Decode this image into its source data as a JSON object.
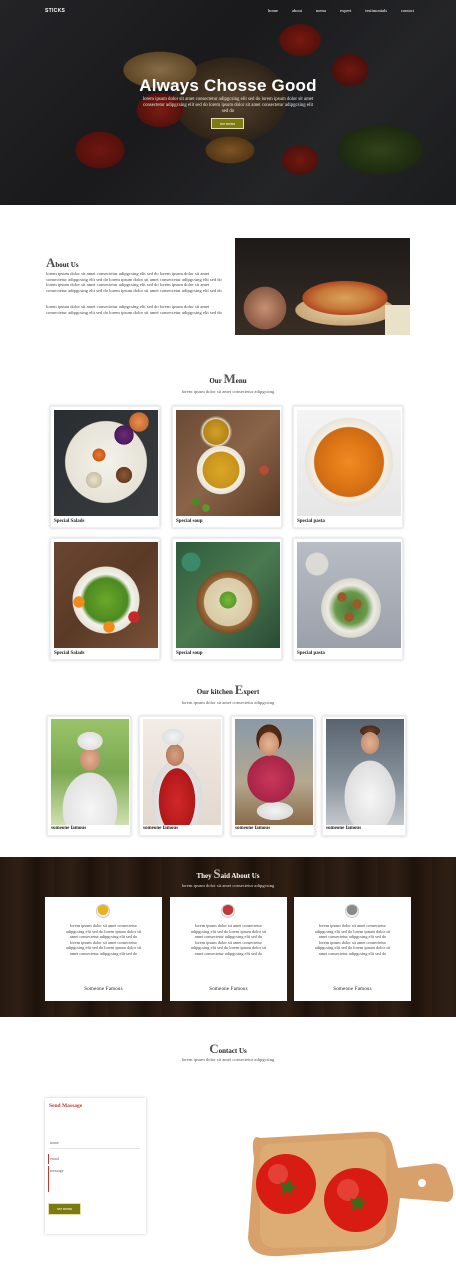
{
  "header": {
    "brand": "STICKS",
    "nav": [
      "home",
      "about",
      "menu",
      "expert",
      "testimonials",
      "contact"
    ]
  },
  "hero": {
    "title": "Always Chosse Good",
    "text": "lorem ipsum dolor sit amet consectetur adipgcsing elit sed do lorem ipsum dolor sit amet consectetur adipgcsing elit sed do lorem ipsum dolor sit amet consectetur adipgcsing elit sed do",
    "button": "see menu"
  },
  "about": {
    "title_first": "A",
    "title_rest": "bout Us",
    "p1": "lorem ipsum dolor sit amet consectetur adipgcsing elit sed do lorem ipsum dolor sit amet consectetur adipgcsing elit sed do lorem ipsum dolor sit amet consectetur adipgcsing elit sed do lorem ipsum dolor sit amet consectetur adipgcsing elit sed do lorem ipsum dolor sit amet consectetur adipgcsing elit sed do lorem ipsum dolor sit amet consectetur adipgcsing elit sed do",
    "p2": "lorem ipsum dolor sit amet consectetur adipgcsing elit sed do lorem ipsum dolor sit amet consectetur adipgcsing elit sed do lorem ipsum dolor sit amet consectetur adipgcsing elit sed do"
  },
  "menu": {
    "title_pre": "Our ",
    "title_first": "M",
    "title_rest": "enu",
    "subtitle": "lorem ipsum dolor sit amet consectetur adipgcsing",
    "items": [
      {
        "caption": "Special Salads"
      },
      {
        "caption": "Special soup"
      },
      {
        "caption": "Special pasta"
      },
      {
        "caption": "Special Salads"
      },
      {
        "caption": "Special soup"
      },
      {
        "caption": "Special pasta"
      }
    ]
  },
  "experts": {
    "title_pre": "Our kitchen ",
    "title_first": "E",
    "title_rest": "xpert",
    "subtitle": "lorem ipsum dolor sit amet consectetur adipgcsing",
    "items": [
      {
        "caption": "someone famous"
      },
      {
        "caption": "someone famous"
      },
      {
        "caption": "someone famous"
      },
      {
        "caption": "someone famous"
      }
    ]
  },
  "testimonials": {
    "title_pre": "They ",
    "title_first": "S",
    "title_rest": "aid About Us",
    "subtitle": "lorem ipsum dolor sit amet consectetur adipgcsing",
    "items": [
      {
        "text": "lorem ipsum dolor sit amet consectetur adipgcsing elit sed do lorem ipsum dolor sit amet consectetur adipgcsing elit sed do lorem ipsum dolor sit amet consectetur adipgcsing elit sed do lorem ipsum dolor sit amet consectetur adipgcsing elit sed do",
        "name": "Someone Famous",
        "avatar_color": "#e8b41c"
      },
      {
        "text": "lorem ipsum dolor sit amet consectetur adipgcsing elit sed do lorem ipsum dolor sit amet consectetur adipgcsing elit sed do lorem ipsum dolor sit amet consectetur adipgcsing elit sed do lorem ipsum dolor sit amet consectetur adipgcsing elit sed do",
        "name": "Someone Famous",
        "avatar_color": "#c03a3a"
      },
      {
        "text": "lorem ipsum dolor sit amet consectetur adipgcsing elit sed do lorem ipsum dolor sit amet consectetur adipgcsing elit sed do lorem ipsum dolor sit amet consectetur adipgcsing elit sed do lorem ipsum dolor sit amet consectetur adipgcsing elit sed do",
        "name": "Someone Famous",
        "avatar_color": "#8a8a8a"
      }
    ]
  },
  "contact": {
    "title_first": "C",
    "title_rest": "ontact Us",
    "subtitle": "lorem ipsum dolor sit amet consectetur adipgcsing",
    "form": {
      "title": "Send Massage",
      "name_label": "name",
      "email_label": "email",
      "message_label": "message",
      "button": "see menu"
    }
  },
  "colors": {
    "accent": "#7d7a12",
    "form_accent": "#c0392b"
  }
}
